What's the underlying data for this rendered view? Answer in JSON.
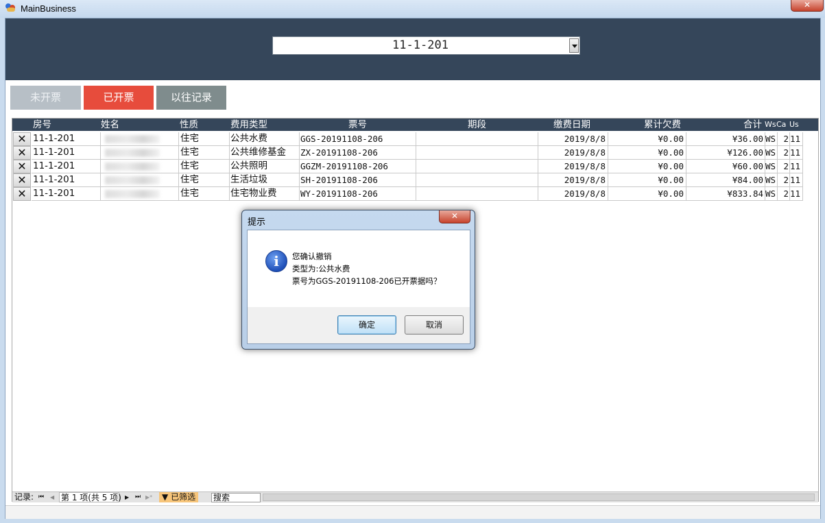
{
  "window": {
    "title": "MainBusiness",
    "close_glyph": "✕"
  },
  "selector": {
    "value": "11-1-201"
  },
  "tabs": [
    {
      "label": "未开票"
    },
    {
      "label": "已开票"
    },
    {
      "label": "以往记录"
    }
  ],
  "table": {
    "headers": [
      "房号",
      "姓名",
      "性质",
      "费用类型",
      "票号",
      "期段",
      "缴费日期",
      "累计欠费",
      "合计",
      "Ws",
      "Ca",
      "Us"
    ],
    "rows": [
      {
        "room": "11-1-201",
        "name": "",
        "kind": "住宅",
        "fee_type": "公共水费",
        "ticket": "GGS-20191108-206",
        "period": "",
        "date": "2019/8/8",
        "arrears": "¥0.00",
        "total": "¥36.00",
        "ws": "WS",
        "ca": "2",
        "us": "11"
      },
      {
        "room": "11-1-201",
        "name": "",
        "kind": "住宅",
        "fee_type": "公共维修基金",
        "ticket": "ZX-20191108-206",
        "period": "",
        "date": "2019/8/8",
        "arrears": "¥0.00",
        "total": "¥126.00",
        "ws": "WS",
        "ca": "2",
        "us": "11"
      },
      {
        "room": "11-1-201",
        "name": "",
        "kind": "住宅",
        "fee_type": "公共照明",
        "ticket": "GGZM-20191108-206",
        "period": "",
        "date": "2019/8/8",
        "arrears": "¥0.00",
        "total": "¥60.00",
        "ws": "WS",
        "ca": "2",
        "us": "11"
      },
      {
        "room": "11-1-201",
        "name": "",
        "kind": "住宅",
        "fee_type": "生活垃圾",
        "ticket": "SH-20191108-206",
        "period": "",
        "date": "2019/8/8",
        "arrears": "¥0.00",
        "total": "¥84.00",
        "ws": "WS",
        "ca": "2",
        "us": "11"
      },
      {
        "room": "11-1-201",
        "name": "",
        "kind": "住宅",
        "fee_type": "住宅物业费",
        "ticket": "WY-20191108-206",
        "period": "",
        "date": "2019/8/8",
        "arrears": "¥0.00",
        "total": "¥833.84",
        "ws": "WS",
        "ca": "2",
        "us": "11"
      }
    ],
    "delete_glyph": "✕"
  },
  "navigator": {
    "label": "记录:",
    "first": "⏮",
    "prev": "◀",
    "position": "第 1 项(共 5 项)",
    "next": "▶",
    "last": "⏭",
    "new": "▶*",
    "filter_label": "已筛选",
    "search_label": "搜索"
  },
  "dialog": {
    "title": "提示",
    "close_glyph": "✕",
    "icon": "info-icon",
    "icon_glyph": "i",
    "lines": [
      "您确认撤销",
      "类型为:公共水费",
      "票号为GGS-20191108-206已开票据吗？"
    ],
    "ok_label": "确定",
    "cancel_label": "取消"
  }
}
